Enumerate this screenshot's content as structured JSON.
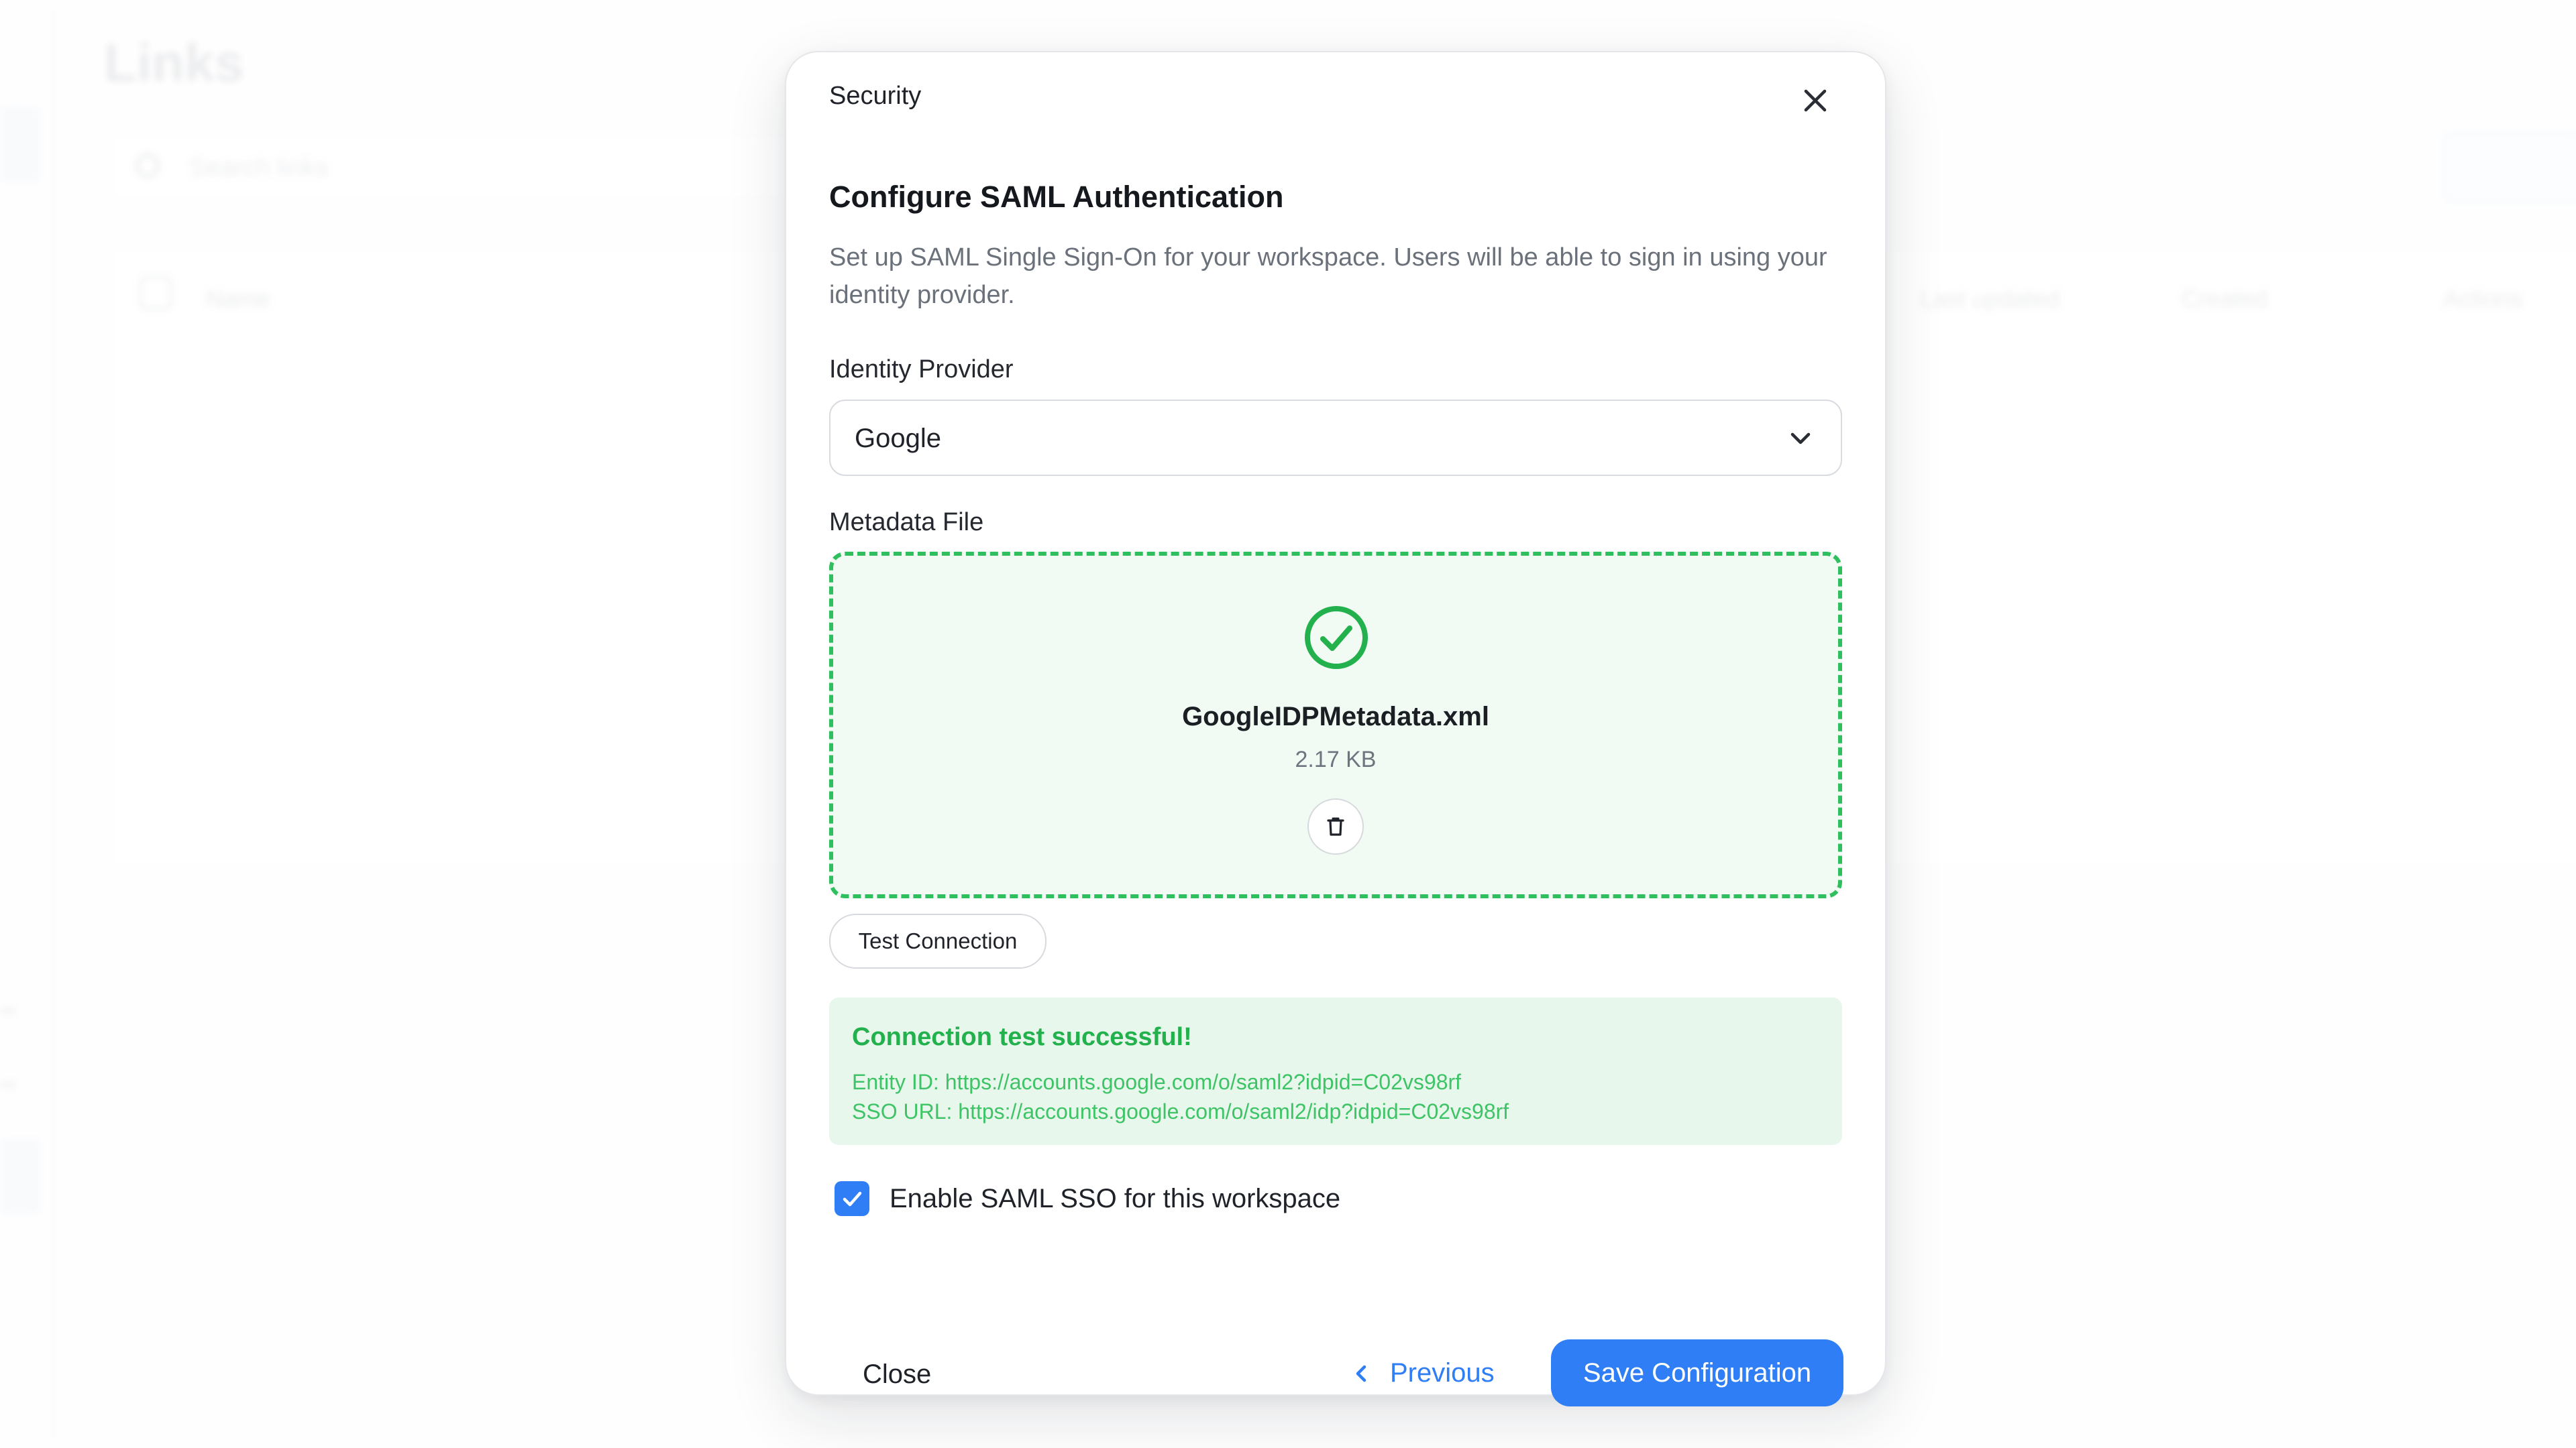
{
  "background": {
    "page_title": "Links",
    "search_placeholder": "Search links",
    "table_headers": [
      "Name",
      "Last updated",
      "Created",
      "Actions"
    ]
  },
  "modal": {
    "header_title": "Security",
    "section_title": "Configure SAML Authentication",
    "description": "Set up SAML Single Sign-On for your workspace. Users will be able to sign in using your identity provider.",
    "identity_provider": {
      "label": "Identity Provider",
      "value": "Google"
    },
    "metadata_file": {
      "label": "Metadata File",
      "file_name": "GoogleIDPMetadata.xml",
      "file_size": "2.17 KB"
    },
    "test_button_label": "Test Connection",
    "result": {
      "title": "Connection test successful!",
      "entity_id": "Entity ID: https://accounts.google.com/o/saml2?idpid=C02vs98rf",
      "sso_url": "SSO URL: https://accounts.google.com/o/saml2/idp?idpid=C02vs98rf"
    },
    "enable_sso": {
      "label": "Enable SAML SSO for this workspace",
      "checked": true
    },
    "footer": {
      "close_label": "Close",
      "previous_label": "Previous",
      "save_label": "Save Configuration"
    }
  },
  "icons": {
    "close": "close-icon",
    "dropdown": "chevron-down-icon",
    "uploaded": "check-circle-icon",
    "delete": "trash-icon",
    "checkbox": "checkmark-icon",
    "previous": "chevron-left-icon"
  },
  "colors": {
    "accent": "#2f7ef6",
    "success": "#22b14c",
    "success_bg": "#e8f7ec",
    "dropzone_border": "#2fbf5e"
  }
}
